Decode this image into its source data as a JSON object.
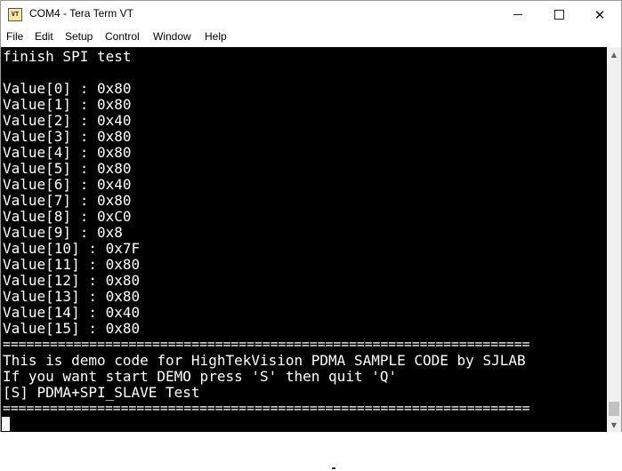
{
  "window": {
    "title": "COM4 - Tera Term VT",
    "icon_label": "VT"
  },
  "menu": {
    "items": [
      "File",
      "Edit",
      "Setup",
      "Control",
      "Window",
      "Help"
    ]
  },
  "terminal": {
    "lines": [
      "finish SPI test",
      "",
      "Value[0] : 0x80",
      "Value[1] : 0x80",
      "Value[2] : 0x40",
      "Value[3] : 0x80",
      "Value[4] : 0x80",
      "Value[5] : 0x80",
      "Value[6] : 0x40",
      "Value[7] : 0x80",
      "Value[8] : 0xC0",
      "Value[9] : 0x8",
      "Value[10] : 0x7F",
      "Value[11] : 0x80",
      "Value[12] : 0x80",
      "Value[13] : 0x80",
      "Value[14] : 0x40",
      "Value[15] : 0x80",
      "===================================================================",
      "This is demo code for HighTekVision PDMA SAMPLE CODE by SJLAB",
      "If you want start DEMO press 'S' then quit 'Q'",
      "[S] PDMA+SPI_SLAVE Test",
      "==================================================================="
    ]
  },
  "colors": {
    "terminal_bg": "#000000",
    "terminal_fg": "#ffffff"
  }
}
